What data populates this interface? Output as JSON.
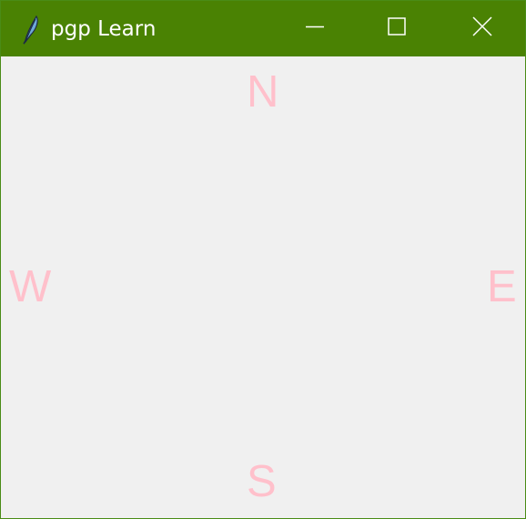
{
  "window": {
    "title": "pgp Learn",
    "titlebar_color": "#4a8203",
    "icons": {
      "app": "feather-icon",
      "minimize": "minimize-icon",
      "maximize": "maximize-icon",
      "close": "close-icon"
    }
  },
  "compass": {
    "color": "#ffc0cb",
    "north": "N",
    "west": "W",
    "east": "E",
    "south": "S"
  }
}
